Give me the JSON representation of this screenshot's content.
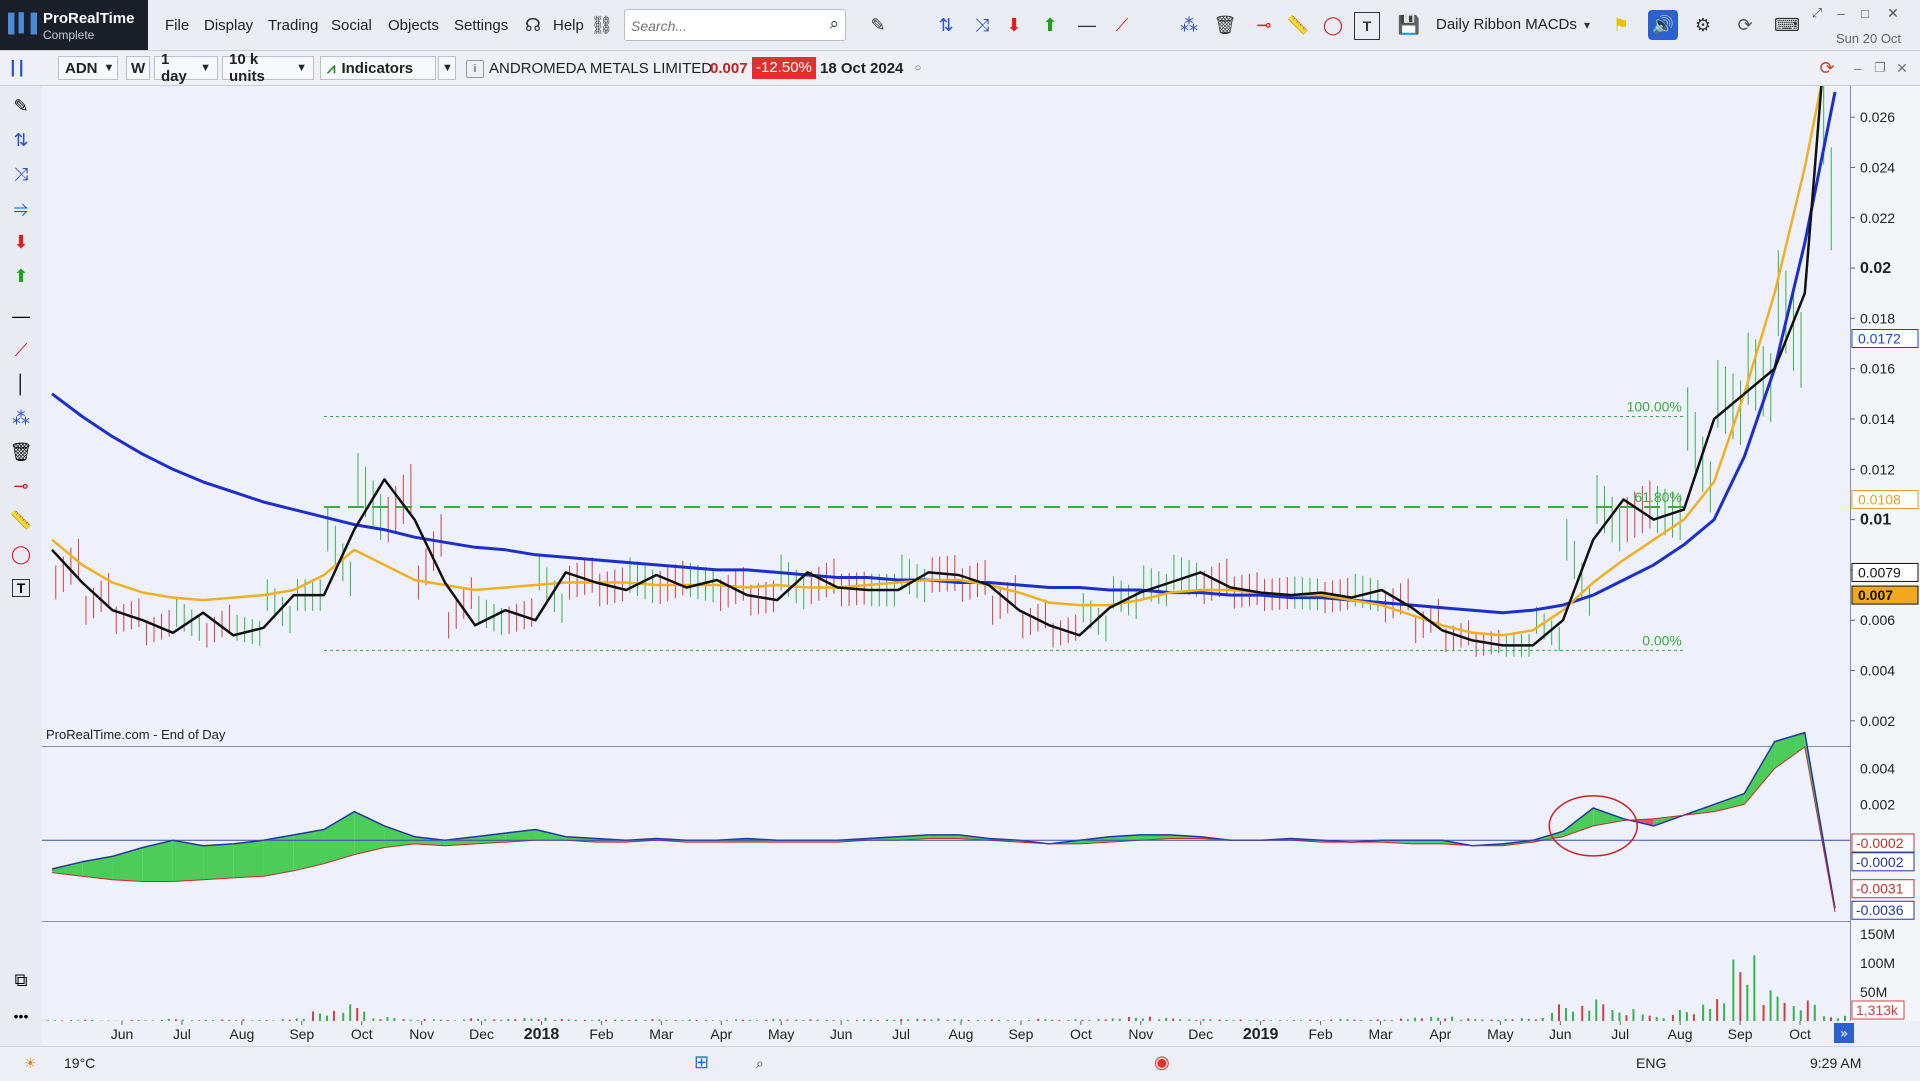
{
  "app": {
    "name": "ProRealTime",
    "edition": "Complete"
  },
  "menu": [
    "File",
    "Display",
    "Trading",
    "Social",
    "Objects",
    "Settings",
    "Help"
  ],
  "search": {
    "placeholder": "Search..."
  },
  "ribbon_preset": "Daily Ribbon MACDs",
  "clock_date": "Sun 20 Oct",
  "toolbar2": {
    "symbol": "ADN",
    "interval_btn": "W",
    "period": "1 day",
    "units": "10 k units",
    "indicators_label": "Indicators",
    "security_name": "ANDROMEDA METALS LIMITED",
    "last_price": "0.007",
    "change_pct": "-12.50%",
    "date": "18 Oct 2024"
  },
  "source_label": "ProRealTime.com - End of Day",
  "price_axis": {
    "ticks": [
      "0.026",
      "0.024",
      "0.022",
      "0.02",
      "0.018",
      "0.016",
      "0.014",
      "0.012",
      "0.01",
      "0.008",
      "0.006",
      "0.004",
      "0.002"
    ],
    "markers": [
      {
        "text": "0.0172",
        "color": "#1c3fd0"
      },
      {
        "text": "0.0108",
        "color": "#e0a020"
      },
      {
        "text": "0.0079",
        "color": "#111111"
      },
      {
        "text": "0.007",
        "color": "#111111"
      }
    ]
  },
  "fib": [
    {
      "label": "100.00%",
      "value": 0.0141
    },
    {
      "label": "61.80%",
      "value": 0.0105
    },
    {
      "label": "0.00%",
      "value": 0.0048
    }
  ],
  "macd_axis": {
    "ticks": [
      "0.004",
      "0.002"
    ],
    "markers": [
      {
        "text": "-0.0002",
        "color": "#c0302a"
      },
      {
        "text": "-0.0002",
        "color": "#2236a0"
      },
      {
        "text": "-0.0031",
        "color": "#c0302a"
      },
      {
        "text": "-0.0036",
        "color": "#2236a0"
      }
    ]
  },
  "volume_axis": {
    "ticks": [
      "150M",
      "100M",
      "50M"
    ],
    "marker": "1,313k"
  },
  "time_axis": [
    "Jun",
    "Jul",
    "Aug",
    "Sep",
    "Oct",
    "Nov",
    "Dec",
    "2018",
    "Feb",
    "Mar",
    "Apr",
    "May",
    "Jun",
    "Jul",
    "Aug",
    "Sep",
    "Oct",
    "Nov",
    "Dec",
    "2019",
    "Feb",
    "Mar",
    "Apr",
    "May",
    "Jun",
    "Jul",
    "Aug",
    "Sep",
    "Oct"
  ],
  "taskbar": {
    "weather": "19°C",
    "lang": "ENG",
    "time": "9:29 AM"
  },
  "chart_data": {
    "type": "line",
    "price": {
      "ylim": [
        0.001,
        0.027
      ],
      "close": [
        0.0088,
        0.0075,
        0.0064,
        0.006,
        0.0055,
        0.0063,
        0.0054,
        0.0057,
        0.007,
        0.007,
        0.0096,
        0.0116,
        0.01,
        0.0075,
        0.0058,
        0.0064,
        0.006,
        0.0079,
        0.0075,
        0.0072,
        0.0078,
        0.0073,
        0.0076,
        0.007,
        0.0068,
        0.0079,
        0.0073,
        0.0072,
        0.0072,
        0.0079,
        0.0078,
        0.0074,
        0.0064,
        0.0058,
        0.0054,
        0.0065,
        0.0071,
        0.0075,
        0.0079,
        0.0073,
        0.0071,
        0.007,
        0.0071,
        0.0069,
        0.0072,
        0.0065,
        0.0056,
        0.0052,
        0.005,
        0.005,
        0.006,
        0.0092,
        0.0108,
        0.01,
        0.0104,
        0.014,
        0.015,
        0.016,
        0.019,
        0.034
      ],
      "ma_orange": [
        0.0092,
        0.0082,
        0.0075,
        0.0071,
        0.0069,
        0.0068,
        0.0069,
        0.007,
        0.0072,
        0.0078,
        0.0088,
        0.0082,
        0.0076,
        0.0074,
        0.0072,
        0.0073,
        0.0074,
        0.0075,
        0.0075,
        0.0075,
        0.0074,
        0.0074,
        0.0074,
        0.0073,
        0.0074,
        0.0073,
        0.0073,
        0.0074,
        0.0075,
        0.0076,
        0.0076,
        0.0074,
        0.0071,
        0.0067,
        0.0066,
        0.0066,
        0.0068,
        0.0071,
        0.0072,
        0.0072,
        0.0071,
        0.007,
        0.007,
        0.0068,
        0.0066,
        0.0062,
        0.0058,
        0.0055,
        0.0054,
        0.0056,
        0.0064,
        0.0075,
        0.0084,
        0.0092,
        0.01,
        0.0115,
        0.015,
        0.019,
        0.024,
        0.03
      ],
      "ma_blue": [
        0.015,
        0.0141,
        0.0133,
        0.0126,
        0.012,
        0.0115,
        0.0111,
        0.0107,
        0.0104,
        0.0101,
        0.0098,
        0.0096,
        0.0093,
        0.0091,
        0.0089,
        0.0088,
        0.0086,
        0.0085,
        0.0084,
        0.0083,
        0.0082,
        0.0081,
        0.008,
        0.008,
        0.0079,
        0.0078,
        0.0077,
        0.0077,
        0.0076,
        0.0076,
        0.0075,
        0.0075,
        0.0074,
        0.0073,
        0.0073,
        0.0072,
        0.0072,
        0.0071,
        0.0071,
        0.007,
        0.007,
        0.0069,
        0.0069,
        0.0068,
        0.0067,
        0.0066,
        0.0065,
        0.0064,
        0.0063,
        0.0064,
        0.0066,
        0.007,
        0.0076,
        0.0082,
        0.009,
        0.01,
        0.0125,
        0.016,
        0.021,
        0.027
      ]
    },
    "macd": {
      "ylim": [
        -0.0045,
        0.0052
      ],
      "upper": [
        -0.0016,
        -0.0012,
        -0.0009,
        -0.0004,
        0.0,
        -0.0003,
        -0.0002,
        0.0,
        0.0003,
        0.0006,
        0.0016,
        0.0008,
        0.0002,
        0.0,
        0.0002,
        0.0004,
        0.0006,
        0.0002,
        0.0001,
        0.0,
        0.0001,
        0.0,
        0.0,
        0.0001,
        0.0,
        0.0,
        0.0,
        0.0001,
        0.0002,
        0.0003,
        0.0003,
        0.0001,
        0.0,
        -0.0002,
        0.0,
        0.0002,
        0.0003,
        0.0003,
        0.0002,
        0.0,
        0.0,
        0.0001,
        0.0,
        -0.0001,
        0.0,
        0.0,
        0.0,
        -0.0003,
        -0.0002,
        0.0,
        0.0005,
        0.0018,
        0.0012,
        0.0008,
        0.0014,
        0.002,
        0.0026,
        0.0055,
        0.006,
        -0.0038
      ],
      "lower": [
        -0.0018,
        -0.002,
        -0.0022,
        -0.0023,
        -0.0023,
        -0.0022,
        -0.0021,
        -0.002,
        -0.0017,
        -0.0013,
        -0.0008,
        -0.0004,
        -0.0002,
        -0.0003,
        -0.0002,
        -0.0001,
        0.0,
        0.0,
        -0.0001,
        -0.0001,
        0.0,
        -0.0001,
        -0.0001,
        -0.0001,
        -0.0001,
        -0.0001,
        -0.0001,
        0.0,
        0.0,
        0.0001,
        0.0001,
        0.0,
        -0.0001,
        -0.0002,
        -0.0002,
        -0.0001,
        0.0,
        0.0001,
        0.0001,
        0.0,
        0.0,
        0.0,
        -0.0001,
        -0.0001,
        -0.0001,
        -0.0002,
        -0.0002,
        -0.0003,
        -0.0003,
        -0.0001,
        0.0002,
        0.0008,
        0.0011,
        0.0012,
        0.0014,
        0.0016,
        0.002,
        0.004,
        0.0052,
        -0.004
      ]
    },
    "volume_m": [
      2,
      3,
      1,
      2,
      4,
      2,
      3,
      2,
      5,
      20,
      35,
      8,
      4,
      3,
      5,
      4,
      6,
      4,
      3,
      3,
      4,
      3,
      2,
      3,
      4,
      3,
      2,
      3,
      4,
      5,
      4,
      3,
      2,
      4,
      3,
      5,
      8,
      6,
      4,
      3,
      3,
      2,
      3,
      4,
      3,
      6,
      8,
      5,
      4,
      6,
      35,
      45,
      25,
      12,
      20,
      40,
      120,
      60,
      40,
      10
    ]
  }
}
